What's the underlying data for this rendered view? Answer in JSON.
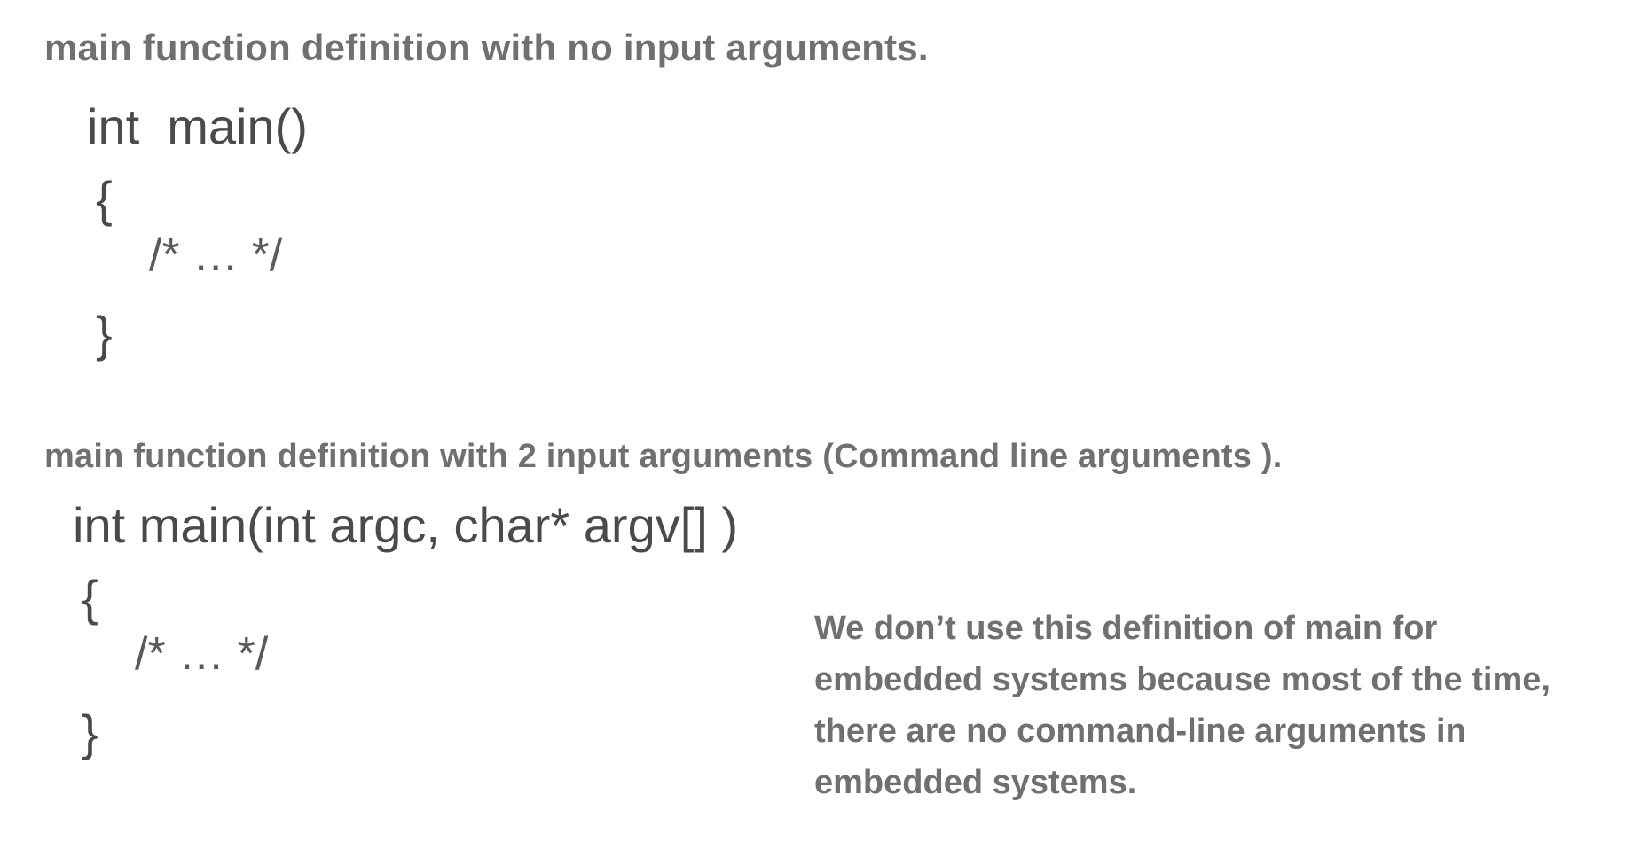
{
  "section1": {
    "heading": "main function definition with no input arguments.",
    "code": {
      "signature": "int  main()",
      "open_brace": "{",
      "comment": "/* … */",
      "close_brace": "}"
    }
  },
  "section2": {
    "heading": "main function definition with 2 input arguments  (Command line arguments ).",
    "code": {
      "signature": "int main(int argc, char* argv[] )",
      "open_brace": "{",
      "comment": "/* … */",
      "close_brace": "}"
    }
  },
  "note": {
    "lines": [
      "We don’t use this definition of main for",
      "embedded systems because most of the time,",
      "there are no command-line arguments in",
      "embedded systems."
    ]
  },
  "colors": {
    "heading_text": "#707070",
    "code_text": "#4a4a4a",
    "background": "#ffffff"
  }
}
